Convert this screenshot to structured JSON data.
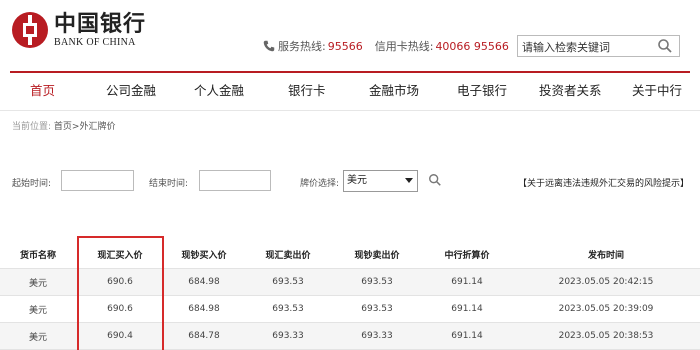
{
  "brand": {
    "name_cn": "中国银行",
    "name_en": "BANK OF CHINA"
  },
  "colors": {
    "brand_red": "#b81c22",
    "highlight_red": "#d62a2a"
  },
  "hotlines": {
    "service_label": "服务热线:",
    "service_number": "95566",
    "card_label": "信用卡热线:",
    "card_number": "40066 95566"
  },
  "search": {
    "placeholder": "请输入检索关键词",
    "icon": "search-icon"
  },
  "nav": {
    "items": [
      "首页",
      "公司金融",
      "个人金融",
      "银行卡",
      "金融市场",
      "电子银行",
      "投资者关系",
      "关于中行"
    ],
    "active_index": 0
  },
  "breadcrumb": {
    "prefix": "当前位置:",
    "path": "首页>外汇牌价"
  },
  "filters": {
    "start_label": "起始时间:",
    "end_label": "结束时间:",
    "currency_label": "牌价选择:",
    "currency_value": "美元",
    "risk_link": "【关于远离违法违规外汇交易的风险提示】"
  },
  "table": {
    "headers": [
      "货币名称",
      "现汇买入价",
      "现钞买入价",
      "现汇卖出价",
      "现钞卖出价",
      "中行折算价",
      "发布时间"
    ],
    "rows": [
      [
        "美元",
        "690.6",
        "684.98",
        "693.53",
        "693.53",
        "691.14",
        "2023.05.05 20:42:15"
      ],
      [
        "美元",
        "690.6",
        "684.98",
        "693.53",
        "693.53",
        "691.14",
        "2023.05.05 20:39:09"
      ],
      [
        "美元",
        "690.4",
        "684.78",
        "693.33",
        "693.33",
        "691.14",
        "2023.05.05 20:38:53"
      ]
    ],
    "highlighted_column": "现汇买入价"
  }
}
